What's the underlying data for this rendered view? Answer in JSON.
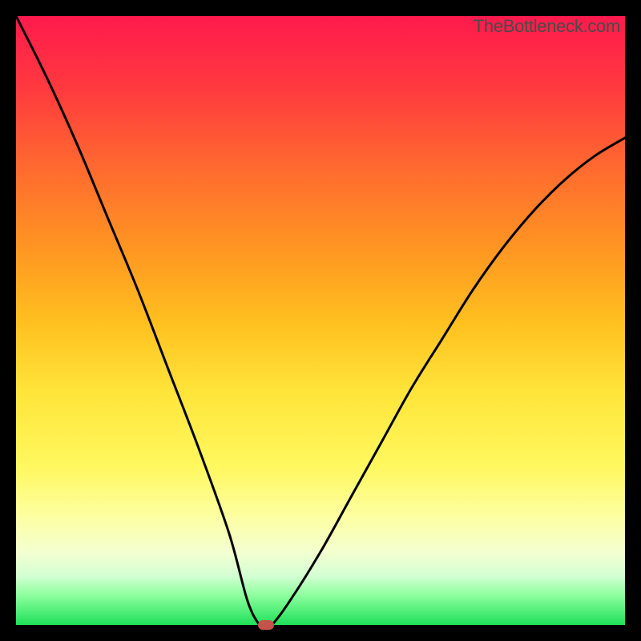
{
  "watermark": "TheBottleneck.com",
  "chart_data": {
    "type": "line",
    "title": "",
    "xlabel": "",
    "ylabel": "",
    "xlim": [
      0,
      100
    ],
    "ylim": [
      0,
      100
    ],
    "series": [
      {
        "name": "bottleneck-curve",
        "x": [
          0,
          5,
          10,
          15,
          20,
          25,
          30,
          35,
          38,
          40,
          41,
          42,
          45,
          50,
          55,
          60,
          65,
          70,
          75,
          80,
          85,
          90,
          95,
          100
        ],
        "values": [
          100,
          90,
          79,
          67,
          55,
          42,
          29,
          15,
          4,
          0,
          0,
          0,
          4,
          12,
          21,
          30,
          39,
          47,
          55,
          62,
          68,
          73,
          77,
          80
        ]
      }
    ],
    "marker": {
      "x": 41,
      "y": 0
    },
    "grid": false,
    "legend": false
  }
}
